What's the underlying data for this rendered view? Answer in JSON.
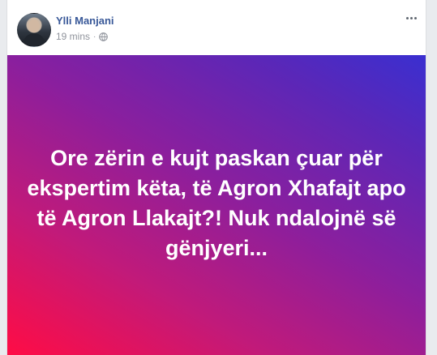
{
  "post": {
    "author": "Ylli Manjani",
    "time": "19 mins",
    "separator": "·",
    "privacy_icon": "globe-icon",
    "more_icon": "more-options-icon",
    "message": "Ore zërin e kujt paskan çuar për ekspertim këta, të Agron Xhafajt apo të Agron Llakajt?! Nuk ndalojnë së gënjyeri...",
    "gradient_colors": [
      "#3a2fd0",
      "#8a1f9e",
      "#ff0c45"
    ]
  }
}
